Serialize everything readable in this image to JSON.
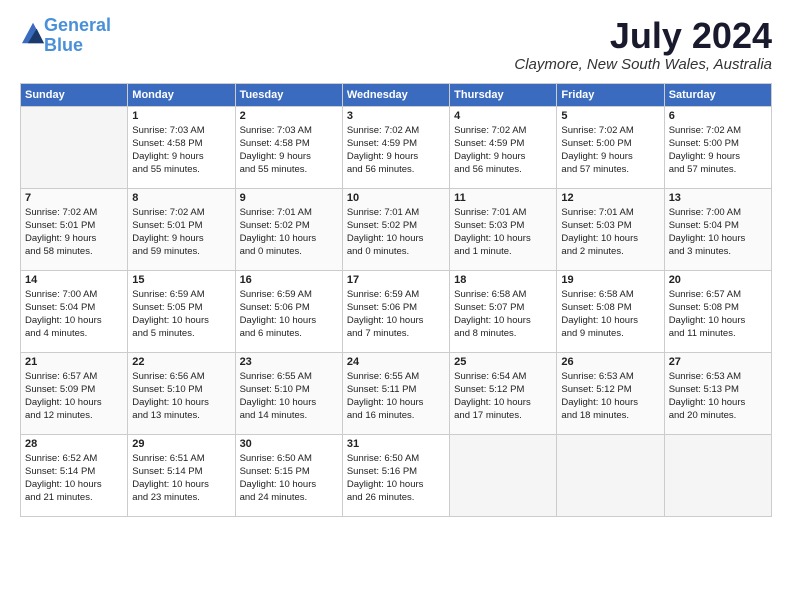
{
  "logo": {
    "line1": "General",
    "line2": "Blue"
  },
  "title": "July 2024",
  "location": "Claymore, New South Wales, Australia",
  "headers": [
    "Sunday",
    "Monday",
    "Tuesday",
    "Wednesday",
    "Thursday",
    "Friday",
    "Saturday"
  ],
  "weeks": [
    [
      {
        "day": "",
        "info": ""
      },
      {
        "day": "1",
        "info": "Sunrise: 7:03 AM\nSunset: 4:58 PM\nDaylight: 9 hours\nand 55 minutes."
      },
      {
        "day": "2",
        "info": "Sunrise: 7:03 AM\nSunset: 4:58 PM\nDaylight: 9 hours\nand 55 minutes."
      },
      {
        "day": "3",
        "info": "Sunrise: 7:02 AM\nSunset: 4:59 PM\nDaylight: 9 hours\nand 56 minutes."
      },
      {
        "day": "4",
        "info": "Sunrise: 7:02 AM\nSunset: 4:59 PM\nDaylight: 9 hours\nand 56 minutes."
      },
      {
        "day": "5",
        "info": "Sunrise: 7:02 AM\nSunset: 5:00 PM\nDaylight: 9 hours\nand 57 minutes."
      },
      {
        "day": "6",
        "info": "Sunrise: 7:02 AM\nSunset: 5:00 PM\nDaylight: 9 hours\nand 57 minutes."
      }
    ],
    [
      {
        "day": "7",
        "info": "Sunrise: 7:02 AM\nSunset: 5:01 PM\nDaylight: 9 hours\nand 58 minutes."
      },
      {
        "day": "8",
        "info": "Sunrise: 7:02 AM\nSunset: 5:01 PM\nDaylight: 9 hours\nand 59 minutes."
      },
      {
        "day": "9",
        "info": "Sunrise: 7:01 AM\nSunset: 5:02 PM\nDaylight: 10 hours\nand 0 minutes."
      },
      {
        "day": "10",
        "info": "Sunrise: 7:01 AM\nSunset: 5:02 PM\nDaylight: 10 hours\nand 0 minutes."
      },
      {
        "day": "11",
        "info": "Sunrise: 7:01 AM\nSunset: 5:03 PM\nDaylight: 10 hours\nand 1 minute."
      },
      {
        "day": "12",
        "info": "Sunrise: 7:01 AM\nSunset: 5:03 PM\nDaylight: 10 hours\nand 2 minutes."
      },
      {
        "day": "13",
        "info": "Sunrise: 7:00 AM\nSunset: 5:04 PM\nDaylight: 10 hours\nand 3 minutes."
      }
    ],
    [
      {
        "day": "14",
        "info": "Sunrise: 7:00 AM\nSunset: 5:04 PM\nDaylight: 10 hours\nand 4 minutes."
      },
      {
        "day": "15",
        "info": "Sunrise: 6:59 AM\nSunset: 5:05 PM\nDaylight: 10 hours\nand 5 minutes."
      },
      {
        "day": "16",
        "info": "Sunrise: 6:59 AM\nSunset: 5:06 PM\nDaylight: 10 hours\nand 6 minutes."
      },
      {
        "day": "17",
        "info": "Sunrise: 6:59 AM\nSunset: 5:06 PM\nDaylight: 10 hours\nand 7 minutes."
      },
      {
        "day": "18",
        "info": "Sunrise: 6:58 AM\nSunset: 5:07 PM\nDaylight: 10 hours\nand 8 minutes."
      },
      {
        "day": "19",
        "info": "Sunrise: 6:58 AM\nSunset: 5:08 PM\nDaylight: 10 hours\nand 9 minutes."
      },
      {
        "day": "20",
        "info": "Sunrise: 6:57 AM\nSunset: 5:08 PM\nDaylight: 10 hours\nand 11 minutes."
      }
    ],
    [
      {
        "day": "21",
        "info": "Sunrise: 6:57 AM\nSunset: 5:09 PM\nDaylight: 10 hours\nand 12 minutes."
      },
      {
        "day": "22",
        "info": "Sunrise: 6:56 AM\nSunset: 5:10 PM\nDaylight: 10 hours\nand 13 minutes."
      },
      {
        "day": "23",
        "info": "Sunrise: 6:55 AM\nSunset: 5:10 PM\nDaylight: 10 hours\nand 14 minutes."
      },
      {
        "day": "24",
        "info": "Sunrise: 6:55 AM\nSunset: 5:11 PM\nDaylight: 10 hours\nand 16 minutes."
      },
      {
        "day": "25",
        "info": "Sunrise: 6:54 AM\nSunset: 5:12 PM\nDaylight: 10 hours\nand 17 minutes."
      },
      {
        "day": "26",
        "info": "Sunrise: 6:53 AM\nSunset: 5:12 PM\nDaylight: 10 hours\nand 18 minutes."
      },
      {
        "day": "27",
        "info": "Sunrise: 6:53 AM\nSunset: 5:13 PM\nDaylight: 10 hours\nand 20 minutes."
      }
    ],
    [
      {
        "day": "28",
        "info": "Sunrise: 6:52 AM\nSunset: 5:14 PM\nDaylight: 10 hours\nand 21 minutes."
      },
      {
        "day": "29",
        "info": "Sunrise: 6:51 AM\nSunset: 5:14 PM\nDaylight: 10 hours\nand 23 minutes."
      },
      {
        "day": "30",
        "info": "Sunrise: 6:50 AM\nSunset: 5:15 PM\nDaylight: 10 hours\nand 24 minutes."
      },
      {
        "day": "31",
        "info": "Sunrise: 6:50 AM\nSunset: 5:16 PM\nDaylight: 10 hours\nand 26 minutes."
      },
      {
        "day": "",
        "info": ""
      },
      {
        "day": "",
        "info": ""
      },
      {
        "day": "",
        "info": ""
      }
    ]
  ]
}
